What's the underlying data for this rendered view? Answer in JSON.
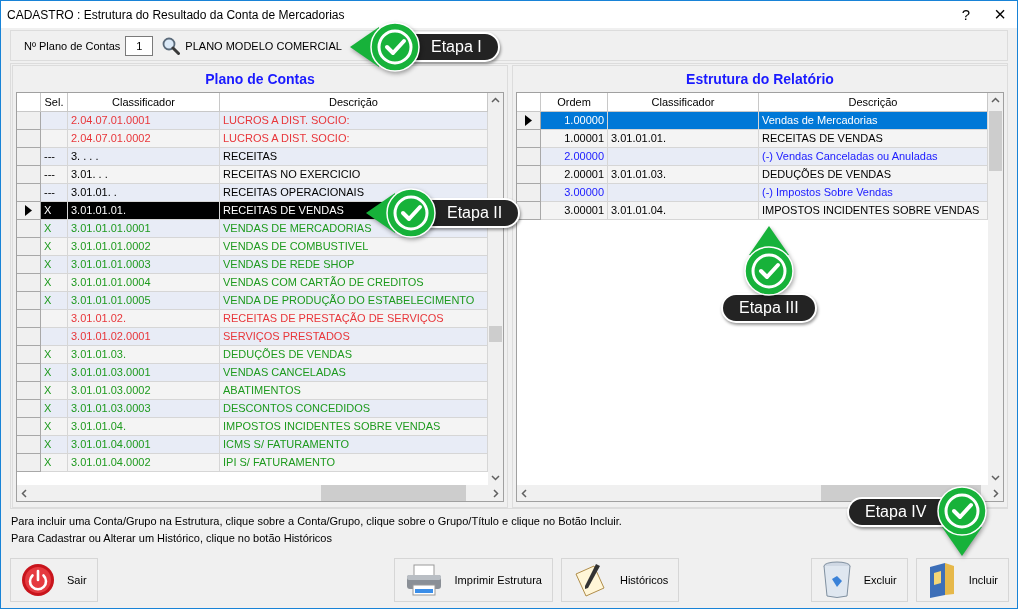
{
  "window": {
    "title": "CADASTRO : Estrutura do Resultado da Conta de Mercadorias",
    "buttons": [
      "?",
      "×"
    ]
  },
  "toolbar": {
    "label": "Nº Plano de Contas",
    "plan_number": "1",
    "plan_name": "PLANO MODELO COMERCIAL"
  },
  "plano_de_contas": {
    "title": "Plano de Contas",
    "columns": [
      "Sel.",
      "Classificador",
      "Descrição"
    ],
    "rows": [
      {
        "classificador": "2.04.07.01.0001",
        "descricao": "LUCROS A DIST. SOCIO:",
        "color": "#e8363a",
        "selected": false
      },
      {
        "classificador": "2.04.07.01.0002",
        "descricao": "LUCROS A DIST. SOCIO:",
        "color": "#e8363a",
        "selected": false
      },
      {
        "sel": "---",
        "classificador": "3.  .  .  .",
        "descricao": "RECEITAS",
        "color": "#000000",
        "selected": false
      },
      {
        "sel": "---",
        "classificador": "3.01.  .  .",
        "descricao": "RECEITAS NO EXERCICIO",
        "color": "#000000",
        "selected": false
      },
      {
        "sel": "---",
        "classificador": "3.01.01.  .",
        "descricao": "RECEITAS OPERACIONAIS",
        "color": "#000000",
        "selected": false
      },
      {
        "sel": "X",
        "classificador": "3.01.01.01.",
        "descricao": "RECEITAS DE VENDAS",
        "selected": true
      },
      {
        "sel": "X",
        "classificador": "3.01.01.01.0001",
        "descricao": "VENDAS DE MERCADORIAS",
        "color": "#1e9a1e",
        "selected": false
      },
      {
        "sel": "X",
        "classificador": "3.01.01.01.0002",
        "descricao": "VENDAS DE COMBUSTIVEL",
        "color": "#1e9a1e",
        "selected": false
      },
      {
        "sel": "X",
        "classificador": "3.01.01.01.0003",
        "descricao": "VENDAS DE REDE SHOP",
        "color": "#1e9a1e",
        "selected": false
      },
      {
        "sel": "X",
        "classificador": "3.01.01.01.0004",
        "descricao": "VENDAS COM CARTÃO DE CREDITOS",
        "color": "#1e9a1e",
        "selected": false
      },
      {
        "sel": "X",
        "classificador": "3.01.01.01.0005",
        "descricao": "VENDA DE PRODUÇÃO DO ESTABELECIMENTO",
        "color": "#1e9a1e",
        "selected": false
      },
      {
        "classificador": "3.01.01.02.",
        "descricao": "RECEITAS DE PRESTAÇÃO DE SERVIÇOS",
        "color": "#e8363a",
        "selected": false
      },
      {
        "classificador": "3.01.01.02.0001",
        "descricao": "SERVIÇOS PRESTADOS",
        "color": "#e8363a",
        "selected": false
      },
      {
        "sel": "X",
        "classificador": "3.01.01.03.",
        "descricao": "DEDUÇÕES DE VENDAS",
        "color": "#1e9a1e",
        "selected": false
      },
      {
        "sel": "X",
        "classificador": "3.01.01.03.0001",
        "descricao": "VENDAS CANCELADAS",
        "color": "#1e9a1e",
        "selected": false
      },
      {
        "sel": "X",
        "classificador": "3.01.01.03.0002",
        "descricao": "ABATIMENTOS",
        "color": "#1e9a1e",
        "selected": false
      },
      {
        "sel": "X",
        "classificador": "3.01.01.03.0003",
        "descricao": "DESCONTOS CONCEDIDOS",
        "color": "#1e9a1e",
        "selected": false
      },
      {
        "sel": "X",
        "classificador": "3.01.01.04.",
        "descricao": "IMPOSTOS INCIDENTES SOBRE VENDAS",
        "color": "#1e9a1e",
        "selected": false
      },
      {
        "sel": "X",
        "classificador": "3.01.01.04.0001",
        "descricao": "ICMS S/ FATURAMENTO",
        "color": "#1e9a1e",
        "selected": false
      },
      {
        "sel": "X",
        "classificador": "3.01.01.04.0002",
        "descricao": "IPI S/ FATURAMENTO",
        "color": "#1e9a1e",
        "selected": false
      }
    ]
  },
  "estrutura": {
    "title": "Estrutura do Relatório",
    "columns": [
      "Ordem",
      "Classificador",
      "Descrição"
    ],
    "rows": [
      {
        "ordem": "1.00000",
        "descricao": "Vendas de Mercadorias",
        "selected": true
      },
      {
        "ordem": "1.00001",
        "classificador": "3.01.01.01.",
        "descricao": "RECEITAS DE VENDAS",
        "color": "#000000",
        "selected": false
      },
      {
        "ordem": "2.00000",
        "descricao": "(-) Vendas Canceladas ou Anuladas",
        "color": "#1a1aff",
        "selected": false
      },
      {
        "ordem": "2.00001",
        "classificador": "3.01.01.03.",
        "descricao": "DEDUÇÕES DE VENDAS",
        "color": "#000000",
        "selected": false
      },
      {
        "ordem": "3.00000",
        "descricao": "(-) Impostos Sobre Vendas",
        "color": "#1a1aff",
        "selected": false
      },
      {
        "ordem": "3.00001",
        "classificador": "3.01.01.04.",
        "descricao": "IMPOSTOS INCIDENTES SOBRE VENDAS",
        "color": "#000000",
        "selected": false
      }
    ]
  },
  "hints": [
    "Para incluir uma Conta/Grupo na Estrutura, clique sobre a Conta/Grupo, clique sobre o Grupo/Título e clique no Botão Incluir.",
    "Para Cadastrar ou Alterar um Histórico, clique no botão Históricos"
  ],
  "buttons": [
    {
      "label": "Sair",
      "kind": "exit"
    },
    {
      "label": "Imprimir Estrutura",
      "kind": "print"
    },
    {
      "label": "Históricos",
      "kind": "history"
    },
    {
      "label": "Excluir",
      "kind": "delete"
    },
    {
      "label": "Incluir",
      "kind": "include"
    }
  ],
  "callouts": [
    {
      "label": "Etapa I",
      "kind": "left"
    },
    {
      "label": "Etapa II",
      "kind": "left"
    },
    {
      "label": "Etapa III",
      "kind": "up"
    },
    {
      "label": "Etapa IV",
      "kind": "down"
    }
  ]
}
